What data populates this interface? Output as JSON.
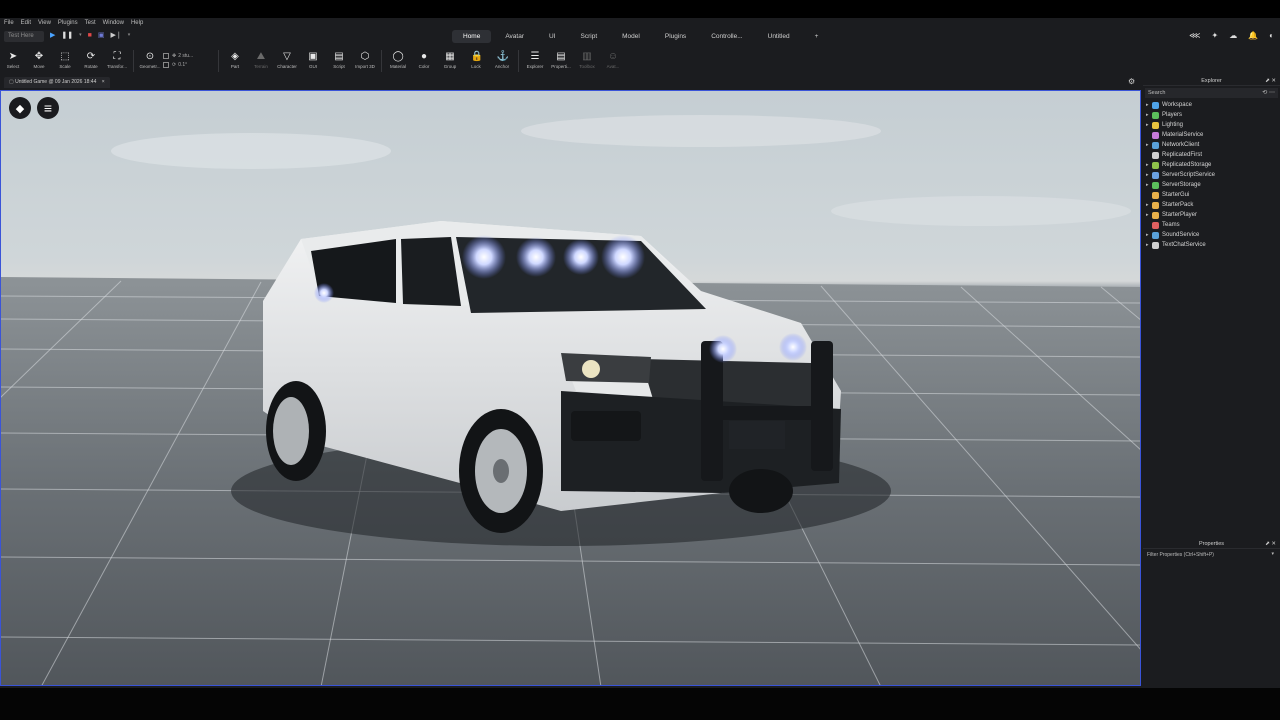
{
  "menubar": {
    "items": [
      "File",
      "Edit",
      "View",
      "Plugins",
      "Test",
      "Window",
      "Help"
    ]
  },
  "playbar": {
    "target_label": "Test Here"
  },
  "ribbon": {
    "tabs": [
      "Home",
      "Avatar",
      "UI",
      "Script",
      "Model",
      "Plugins",
      "Controlle...",
      "Untitled"
    ],
    "active_tab": "Home",
    "add_tab_label": "+"
  },
  "toolbar": {
    "tools": [
      {
        "label": "Select",
        "icon": "cursor-icon",
        "glyph": "➤"
      },
      {
        "label": "Move",
        "icon": "move-icon",
        "glyph": "✥"
      },
      {
        "label": "Scale",
        "icon": "scale-icon",
        "glyph": "⬚"
      },
      {
        "label": "Rotate",
        "icon": "rotate-icon",
        "glyph": "⟳"
      },
      {
        "label": "Transfor...",
        "icon": "transform-icon",
        "glyph": "⛶"
      }
    ],
    "geometry_label": "Geometr...",
    "snap": {
      "move_value": "2 stu...",
      "rotate_value": "0.1°"
    },
    "insert_tools": [
      {
        "label": "Part",
        "icon": "part-icon",
        "glyph": "◈"
      },
      {
        "label": "Terrain",
        "icon": "terrain-icon",
        "glyph": "⛰",
        "dim": true
      },
      {
        "label": "Character",
        "icon": "character-icon",
        "glyph": "▽"
      },
      {
        "label": "GUI",
        "icon": "gui-icon",
        "glyph": "▣"
      },
      {
        "label": "Script",
        "icon": "script-icon",
        "glyph": "▤"
      },
      {
        "label": "Import 3D",
        "icon": "import-3d-icon",
        "glyph": "⬡"
      }
    ],
    "edit_tools": [
      {
        "label": "Material",
        "icon": "material-icon",
        "glyph": "◯"
      },
      {
        "label": "Color",
        "icon": "color-icon",
        "glyph": "●"
      },
      {
        "label": "Group",
        "icon": "group-icon",
        "glyph": "▦"
      },
      {
        "label": "Lock",
        "icon": "lock-icon",
        "glyph": "🔒"
      },
      {
        "label": "Anchor",
        "icon": "anchor-icon",
        "glyph": "⚓"
      }
    ],
    "panel_tools": [
      {
        "label": "Explorer",
        "icon": "explorer-icon",
        "glyph": "☰"
      },
      {
        "label": "Properti...",
        "icon": "properties-icon",
        "glyph": "▤"
      },
      {
        "label": "Toolbox",
        "icon": "toolbox-icon",
        "glyph": "▥",
        "dim": true
      },
      {
        "label": "Avat...",
        "icon": "avatar-icon",
        "glyph": "☺",
        "dim": true
      }
    ]
  },
  "document": {
    "tab_title": "Untitled Game @ 09 Jan 2026 18:44",
    "close_glyph": "×"
  },
  "viewport": {
    "roblox_glyph": "◆",
    "menu_glyph": "≡"
  },
  "explorer": {
    "title": "Explorer",
    "search_placeholder": "Search",
    "items": [
      {
        "name": "Workspace",
        "expandable": true,
        "color": "#4fa3e8"
      },
      {
        "name": "Players",
        "expandable": true,
        "color": "#5bbf5b"
      },
      {
        "name": "Lighting",
        "expandable": true,
        "color": "#e8c33f"
      },
      {
        "name": "MaterialService",
        "expandable": false,
        "color": "#c77bd9"
      },
      {
        "name": "NetworkClient",
        "expandable": true,
        "color": "#5aa0d8"
      },
      {
        "name": "ReplicatedFirst",
        "expandable": false,
        "color": "#d0d0d0"
      },
      {
        "name": "ReplicatedStorage",
        "expandable": true,
        "color": "#8fc24a"
      },
      {
        "name": "ServerScriptService",
        "expandable": true,
        "color": "#6aa0e0"
      },
      {
        "name": "ServerStorage",
        "expandable": true,
        "color": "#5bbf5b"
      },
      {
        "name": "StarterGui",
        "expandable": false,
        "color": "#e8b04a"
      },
      {
        "name": "StarterPack",
        "expandable": true,
        "color": "#e8b04a"
      },
      {
        "name": "StarterPlayer",
        "expandable": true,
        "color": "#e8b04a"
      },
      {
        "name": "Teams",
        "expandable": false,
        "color": "#e06060"
      },
      {
        "name": "SoundService",
        "expandable": true,
        "color": "#5aa0d8"
      },
      {
        "name": "TextChatService",
        "expandable": true,
        "color": "#cfcfcf"
      }
    ]
  },
  "properties": {
    "title": "Properties",
    "filter_placeholder": "Filter Properties (Ctrl+Shift+P)"
  },
  "colors": {
    "viewport_border": "#3a54d8",
    "panel_bg": "#1b1c1f",
    "accent_blue": "#4fa3e8"
  }
}
